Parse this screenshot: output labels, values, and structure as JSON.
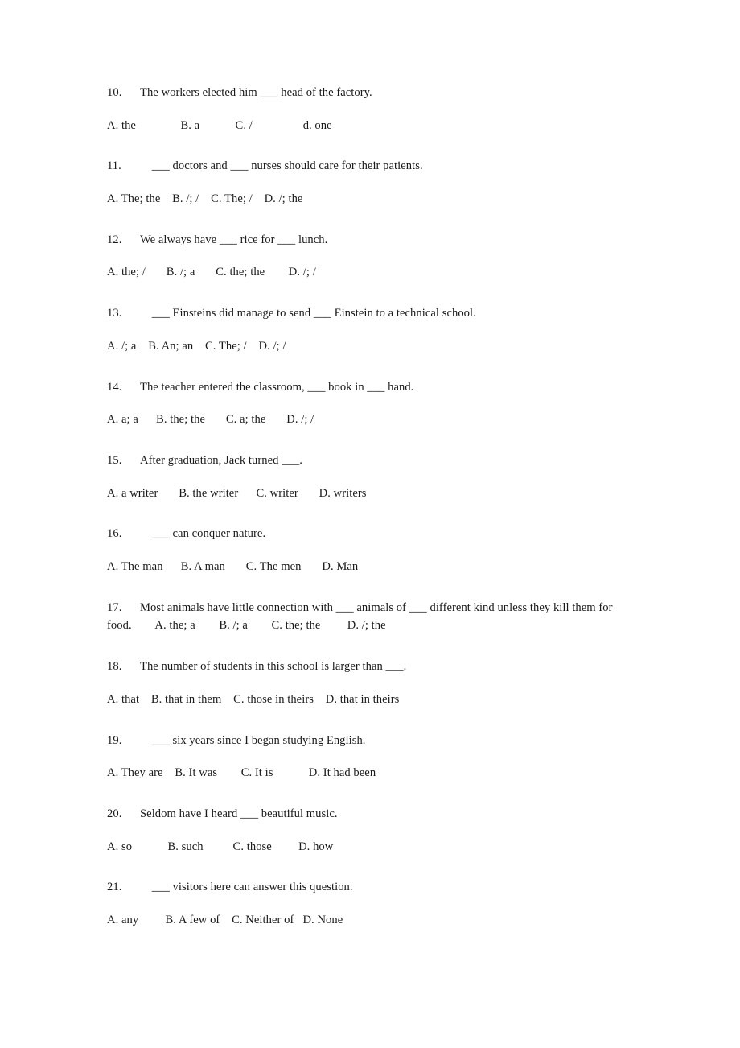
{
  "document": {
    "type": "grammar-worksheet",
    "background_color": "#ffffff",
    "text_color": "#1a1a1a"
  },
  "questions": [
    {
      "number": "10.",
      "stem": "The workers elected him ___ head of the factory.",
      "options_line": "A. the               B. a            C. /                 d. one",
      "layout": "stacked"
    },
    {
      "number": "11.",
      "stem": "    ___ doctors and ___ nurses should care for their patients.",
      "options_line": "A. The; the    B. /; /    C. The; /    D. /; the",
      "layout": "stacked"
    },
    {
      "number": "12.",
      "stem": "We always have ___ rice for ___ lunch.",
      "options_line": "A. the; /       B. /; a       C. the; the        D. /; /",
      "layout": "stacked"
    },
    {
      "number": "13.",
      "stem": "    ___ Einsteins did manage to send ___ Einstein to a technical school.",
      "options_line": "A. /; a    B. An; an    C. The; /    D. /; /",
      "layout": "stacked"
    },
    {
      "number": "14.",
      "stem": "The teacher entered the classroom, ___ book in ___ hand.",
      "options_line": "A. a; a      B. the; the       C. a; the       D. /; /",
      "layout": "stacked"
    },
    {
      "number": "15.",
      "stem": "After graduation, Jack turned ___.",
      "options_line": "A. a writer       B. the writer      C. writer       D. writers",
      "layout": "stacked"
    },
    {
      "number": "16.",
      "stem": "    ___ can conquer nature.",
      "options_line": "A. The man      B. A man       C. The men       D. Man",
      "layout": "stacked"
    },
    {
      "number": "17.",
      "stem": "Most animals have little connection with ___ animals of ___ different kind unless they kill them for food.        A. the; a        B. /; a        C. the; the         D. /; the",
      "options_line": "",
      "layout": "inline"
    },
    {
      "number": "18.",
      "stem": "The number of students in this school is larger than ___.",
      "options_line": "A. that    B. that in them    C. those in theirs    D. that in theirs",
      "layout": "stacked"
    },
    {
      "number": "19.",
      "stem": "    ___ six years since I began studying English.",
      "options_line": "A. They are    B. It was        C. It is            D. It had been",
      "layout": "stacked"
    },
    {
      "number": "20.",
      "stem": "Seldom have I heard ___ beautiful music.",
      "options_line": "A. so            B. such          C. those         D. how",
      "layout": "stacked"
    },
    {
      "number": "21.",
      "stem": "    ___ visitors here can answer this question.",
      "options_line": "A. any         B. A few of    C. Neither of   D. None",
      "layout": "stacked"
    }
  ]
}
